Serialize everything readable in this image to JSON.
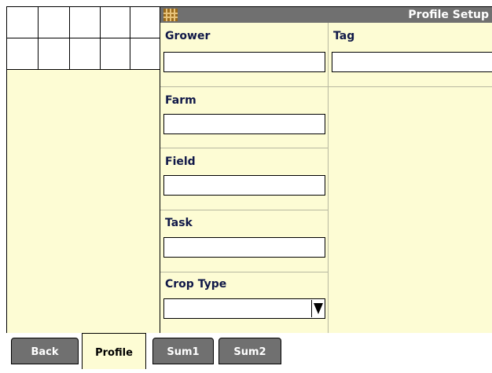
{
  "window": {
    "title": "Profile Setup"
  },
  "fields": {
    "grower": {
      "label": "Grower",
      "value": ""
    },
    "tag": {
      "label": "Tag",
      "value": ""
    },
    "farm": {
      "label": "Farm",
      "value": ""
    },
    "field": {
      "label": "Field",
      "value": ""
    },
    "task": {
      "label": "Task",
      "value": ""
    },
    "crop_type": {
      "label": "Crop Type",
      "value": ""
    }
  },
  "tabs": {
    "back": "Back",
    "profile": "Profile",
    "sum1": "Sum1",
    "sum2": "Sum2"
  },
  "colors": {
    "panel_bg": "#fdfcd4",
    "title_bg": "#707070",
    "tab_bg": "#707070",
    "label_text": "#101848"
  }
}
